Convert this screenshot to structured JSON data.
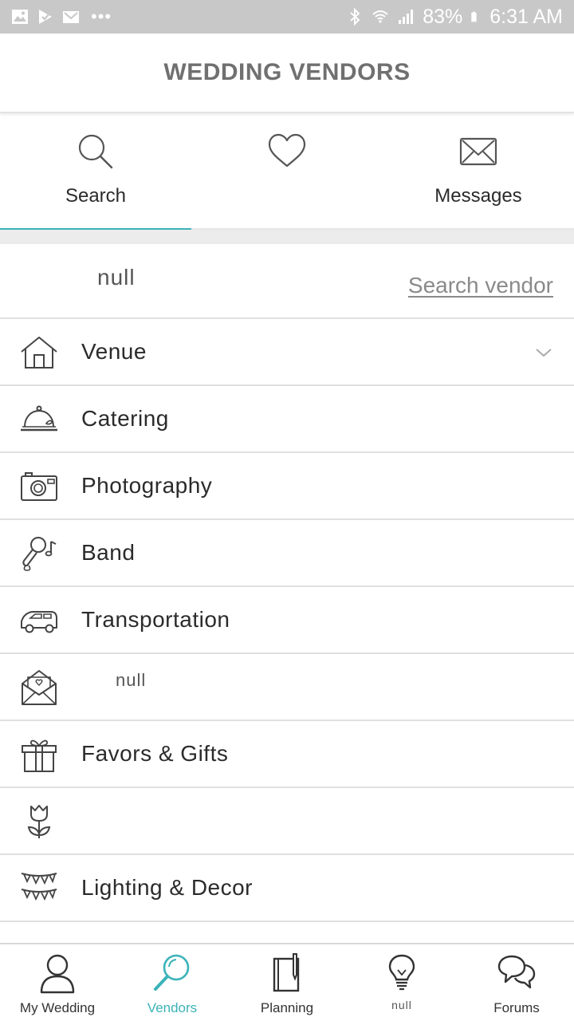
{
  "status_bar": {
    "battery": "83%",
    "time": "6:31 AM",
    "overflow": "•••"
  },
  "header": {
    "title": "WEDDING VENDORS"
  },
  "tabs": [
    {
      "label": "Search",
      "icon": "search-icon",
      "active": true
    },
    {
      "label": "",
      "icon": "heart-icon",
      "active": false
    },
    {
      "label": "Messages",
      "icon": "envelope-icon",
      "active": false
    }
  ],
  "search": {
    "value": "null",
    "link_label": "Search vendor"
  },
  "vendors": [
    {
      "label": "Venue",
      "icon": "house-icon",
      "expandable": true
    },
    {
      "label": "Catering",
      "icon": "cloche-icon"
    },
    {
      "label": "Photography",
      "icon": "camera-icon"
    },
    {
      "label": "Band",
      "icon": "microphone-icon"
    },
    {
      "label": "Transportation",
      "icon": "car-icon"
    },
    {
      "label": "null",
      "icon": "invitation-envelope-icon"
    },
    {
      "label": "Favors & Gifts",
      "icon": "gift-icon"
    },
    {
      "label": "",
      "icon": "tulip-icon"
    },
    {
      "label": "Lighting & Decor",
      "icon": "bunting-icon"
    }
  ],
  "bottom_nav": [
    {
      "label": "My Wedding",
      "icon": "person-icon"
    },
    {
      "label": "Vendors",
      "icon": "magnifier-icon",
      "active": true
    },
    {
      "label": "Planning",
      "icon": "notebook-icon"
    },
    {
      "label": "null",
      "icon": "lightbulb-icon"
    },
    {
      "label": "Forums",
      "icon": "chat-bubbles-icon"
    }
  ],
  "colors": {
    "accent": "#3bb3b8",
    "status_bar": "#c8c8c8",
    "header_title": "#707070",
    "divider": "#e0e0e0"
  }
}
